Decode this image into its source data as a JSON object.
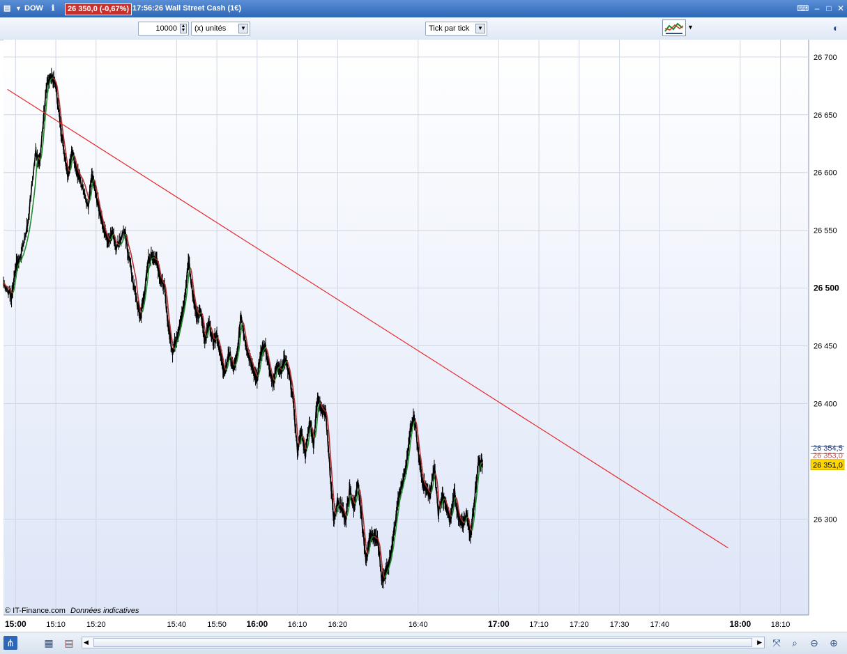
{
  "window": {
    "symbol": "DOW",
    "info_icon": "info-icon",
    "price_badge": "26 350,0 (-0,67%)",
    "time": "17:56:26",
    "instrument": "Wall Street Cash (1€)"
  },
  "toolbar": {
    "quantity_value": "10000",
    "unit_value": "(x) unités",
    "period_value": "Tick par tick"
  },
  "footer": {
    "copyright": "© IT-Finance.com",
    "note": "Données indicatives"
  },
  "colors": {
    "price_line": "#000000",
    "ma_up": "#1f8a2a",
    "ma_down": "#b03030",
    "trendline": "#e8282c",
    "current_label_bg": "#ffd700"
  },
  "chart_data": {
    "type": "line",
    "x_unit": "time of day",
    "x_range": [
      "14:57",
      "18:17"
    ],
    "xticks": [
      {
        "t": "15:00",
        "bold": true
      },
      {
        "t": "15:10",
        "bold": false
      },
      {
        "t": "15:20",
        "bold": false
      },
      {
        "t": "15:40",
        "bold": false
      },
      {
        "t": "15:50",
        "bold": false
      },
      {
        "t": "16:00",
        "bold": true
      },
      {
        "t": "16:10",
        "bold": false
      },
      {
        "t": "16:20",
        "bold": false
      },
      {
        "t": "16:40",
        "bold": false
      },
      {
        "t": "17:00",
        "bold": true
      },
      {
        "t": "17:10",
        "bold": false
      },
      {
        "t": "17:20",
        "bold": false
      },
      {
        "t": "17:30",
        "bold": false
      },
      {
        "t": "17:40",
        "bold": false
      },
      {
        "t": "18:00",
        "bold": true
      },
      {
        "t": "18:10",
        "bold": false
      }
    ],
    "yticks": [
      {
        "v": 26700,
        "label": "26 700",
        "bold": false
      },
      {
        "v": 26650,
        "label": "26 650",
        "bold": false
      },
      {
        "v": 26600,
        "label": "26 600",
        "bold": false
      },
      {
        "v": 26550,
        "label": "26 550",
        "bold": false
      },
      {
        "v": 26500,
        "label": "26 500",
        "bold": true
      },
      {
        "v": 26450,
        "label": "26 450",
        "bold": false
      },
      {
        "v": 26400,
        "label": "26 400",
        "bold": false
      },
      {
        "v": 26300,
        "label": "26 300",
        "bold": false
      }
    ],
    "ylim": [
      26217,
      26715
    ],
    "grid": true,
    "series": [
      {
        "points": [
          [
            "14:57",
            26505
          ],
          [
            "14:59",
            26492
          ],
          [
            "15:00",
            26518
          ],
          [
            "15:01",
            26525
          ],
          [
            "15:03",
            26555
          ],
          [
            "15:05",
            26618
          ],
          [
            "15:06",
            26608
          ],
          [
            "15:07",
            26650
          ],
          [
            "15:08",
            26680
          ],
          [
            "15:09",
            26683
          ],
          [
            "15:10",
            26675
          ],
          [
            "15:11",
            26645
          ],
          [
            "15:12",
            26620
          ],
          [
            "15:13",
            26598
          ],
          [
            "15:14",
            26618
          ],
          [
            "15:15",
            26605
          ],
          [
            "15:16",
            26595
          ],
          [
            "15:18",
            26568
          ],
          [
            "15:19",
            26598
          ],
          [
            "15:20",
            26580
          ],
          [
            "15:21",
            26565
          ],
          [
            "15:22",
            26550
          ],
          [
            "15:23",
            26540
          ],
          [
            "15:24",
            26550
          ],
          [
            "15:25",
            26535
          ],
          [
            "15:27",
            26550
          ],
          [
            "15:28",
            26530
          ],
          [
            "15:30",
            26490
          ],
          [
            "15:31",
            26475
          ],
          [
            "15:32",
            26495
          ],
          [
            "15:33",
            26525
          ],
          [
            "15:34",
            26527
          ],
          [
            "15:35",
            26525
          ],
          [
            "15:36",
            26508
          ],
          [
            "15:37",
            26500
          ],
          [
            "15:38",
            26465
          ],
          [
            "15:39",
            26445
          ],
          [
            "15:40",
            26458
          ],
          [
            "15:41",
            26470
          ],
          [
            "15:42",
            26490
          ],
          [
            "15:43",
            26525
          ],
          [
            "15:44",
            26495
          ],
          [
            "15:45",
            26475
          ],
          [
            "15:46",
            26480
          ],
          [
            "15:47",
            26455
          ],
          [
            "15:48",
            26470
          ],
          [
            "15:49",
            26455
          ],
          [
            "15:50",
            26460
          ],
          [
            "15:51",
            26440
          ],
          [
            "15:52",
            26425
          ],
          [
            "15:53",
            26445
          ],
          [
            "15:54",
            26430
          ],
          [
            "15:55",
            26440
          ],
          [
            "15:56",
            26478
          ],
          [
            "15:57",
            26455
          ],
          [
            "15:58",
            26440
          ],
          [
            "15:59",
            26430
          ],
          [
            "16:00",
            26420
          ],
          [
            "16:01",
            26445
          ],
          [
            "16:02",
            26450
          ],
          [
            "16:03",
            26430
          ],
          [
            "16:04",
            26418
          ],
          [
            "16:05",
            26435
          ],
          [
            "16:06",
            26428
          ],
          [
            "16:07",
            26440
          ],
          [
            "16:08",
            26425
          ],
          [
            "16:09",
            26400
          ],
          [
            "16:10",
            26360
          ],
          [
            "16:11",
            26375
          ],
          [
            "16:12",
            26355
          ],
          [
            "16:13",
            26385
          ],
          [
            "16:14",
            26365
          ],
          [
            "16:15",
            26405
          ],
          [
            "16:16",
            26395
          ],
          [
            "16:17",
            26395
          ],
          [
            "16:18",
            26345
          ],
          [
            "16:19",
            26300
          ],
          [
            "16:20",
            26315
          ],
          [
            "16:21",
            26310
          ],
          [
            "16:22",
            26300
          ],
          [
            "16:23",
            26325
          ],
          [
            "16:24",
            26310
          ],
          [
            "16:25",
            26330
          ],
          [
            "16:26",
            26300
          ],
          [
            "16:27",
            26265
          ],
          [
            "16:28",
            26285
          ],
          [
            "16:29",
            26283
          ],
          [
            "16:30",
            26283
          ],
          [
            "16:31",
            26245
          ],
          [
            "16:32",
            26255
          ],
          [
            "16:33",
            26265
          ],
          [
            "16:34",
            26290
          ],
          [
            "16:35",
            26315
          ],
          [
            "16:36",
            26330
          ],
          [
            "16:37",
            26345
          ],
          [
            "16:38",
            26375
          ],
          [
            "16:39",
            26390
          ],
          [
            "16:40",
            26360
          ],
          [
            "16:41",
            26335
          ],
          [
            "16:42",
            26325
          ],
          [
            "16:43",
            26320
          ],
          [
            "16:44",
            26348
          ],
          [
            "16:45",
            26305
          ],
          [
            "16:46",
            26320
          ],
          [
            "16:47",
            26310
          ],
          [
            "16:48",
            26298
          ],
          [
            "16:49",
            26325
          ],
          [
            "16:50",
            26300
          ],
          [
            "16:51",
            26295
          ],
          [
            "16:52",
            26305
          ],
          [
            "16:53",
            26285
          ],
          [
            "16:54",
            26318
          ],
          [
            "16:55",
            26350
          ],
          [
            "16:56",
            26348
          ]
        ]
      }
    ],
    "trendline": {
      "from": [
        "14:58",
        26672
      ],
      "to": [
        "17:57",
        26275
      ]
    },
    "current_labels": [
      {
        "label": "26 354,5",
        "value": 26354.5,
        "color": "#203a70"
      },
      {
        "label": "26 353,0",
        "value": 26353.0,
        "color": "#c0504d"
      },
      {
        "label": "26 351,0",
        "value": 26351.0,
        "color": "#000000"
      }
    ]
  }
}
